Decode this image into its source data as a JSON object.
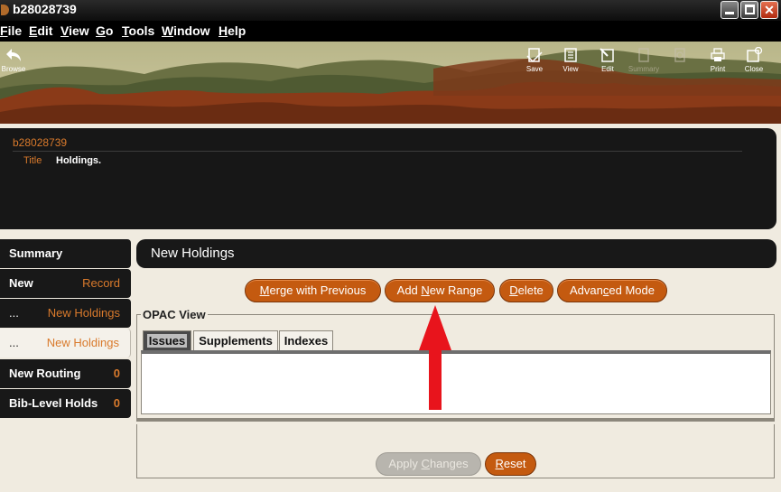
{
  "window": {
    "title": "b28028739"
  },
  "menu": [
    {
      "label": "File",
      "u": "F",
      "rest": "ile"
    },
    {
      "label": "Edit",
      "u": "E",
      "rest": "dit"
    },
    {
      "label": "View",
      "u": "V",
      "rest": "iew"
    },
    {
      "label": "Go",
      "u": "G",
      "rest": "o"
    },
    {
      "label": "Tools",
      "u": "T",
      "rest": "ools"
    },
    {
      "label": "Window",
      "u": "W",
      "rest": "indow"
    },
    {
      "label": "Help",
      "u": "H",
      "rest": "elp"
    }
  ],
  "toolbar": {
    "browse": "Browse",
    "save": "Save",
    "view": "View",
    "edit": "Edit",
    "summary": "Summary",
    "print": "Print",
    "close": "Close"
  },
  "record": {
    "id": "b28028739",
    "title_label": "Title",
    "title_value": "Holdings."
  },
  "sidebar": {
    "items": [
      {
        "left": "Summary",
        "right": ""
      },
      {
        "left": "New",
        "right": "Record"
      },
      {
        "left": "...",
        "right": "New Holdings"
      },
      {
        "left": "...",
        "right": "New Holdings"
      },
      {
        "left": "New Routing",
        "right": "0"
      },
      {
        "left": "Bib-Level Holds",
        "right": "0"
      }
    ]
  },
  "main": {
    "title": "New Holdings",
    "buttons": {
      "merge": {
        "u": "M",
        "rest": "erge with Previous"
      },
      "add_range": {
        "pre": "Add ",
        "u": "N",
        "rest": "ew Range"
      },
      "delete": {
        "u": "D",
        "rest": "elete"
      },
      "advanced": {
        "pre": "Advan",
        "u": "c",
        "rest": "ed Mode"
      }
    },
    "opac_legend": "OPAC View",
    "tabs": [
      "Issues",
      "Supplements",
      "Indexes"
    ],
    "apply": {
      "pre": "Apply ",
      "u": "C",
      "rest": "hanges"
    },
    "reset": {
      "u": "R",
      "rest": "eset"
    }
  },
  "colors": {
    "accent": "#d97a2c",
    "button": "#c45a10",
    "panel": "#181818",
    "arrow": "#e8141c"
  }
}
